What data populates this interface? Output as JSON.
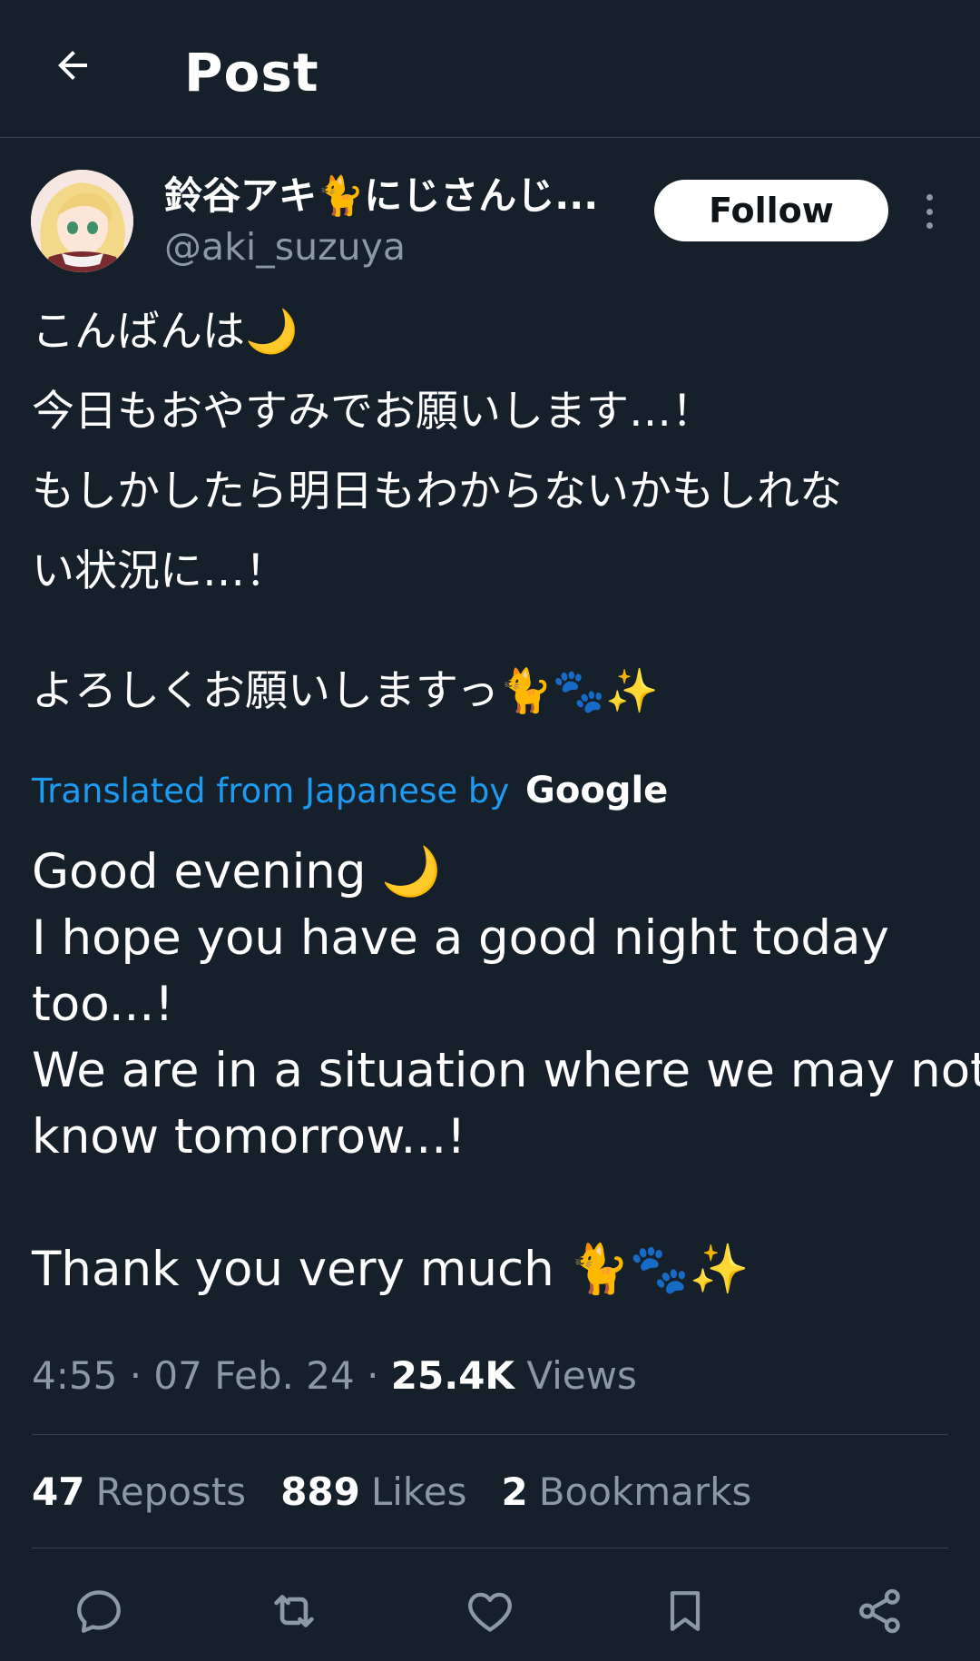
{
  "header": {
    "title": "Post",
    "back_icon": "arrow-left-icon"
  },
  "author": {
    "display_name": "鈴谷アキ🐈にじさんじ...",
    "handle": "@aki_suzuya",
    "follow_label": "Follow"
  },
  "post": {
    "original_lines": [
      "こんばんは🌙",
      "今日もおやすみでお願いします…！",
      "もしかしたら明日もわからないかもしれな",
      "い状況に…！",
      "",
      "よろしくお願いしますっ🐈🐾✨"
    ],
    "translated_label": "Translated from Japanese by",
    "translator": "Google",
    "translation_lines": [
      "Good evening 🌙",
      "I hope you have a good night today",
      "too...!",
      "We are in a situation where we may not",
      "know tomorrow...!",
      "",
      "Thank you very much 🐈🐾✨"
    ]
  },
  "meta": {
    "time": "4:55",
    "sep1": "·",
    "date": "07 Feb. 24",
    "sep2": "·",
    "views_count": "25.4K",
    "views_label": "Views"
  },
  "stats": {
    "reposts_count": "47",
    "reposts_label": "Reposts",
    "likes_count": "889",
    "likes_label": "Likes",
    "bookmarks_count": "2",
    "bookmarks_label": "Bookmarks"
  },
  "actions": [
    {
      "name": "reply",
      "icon": "reply-icon"
    },
    {
      "name": "repost",
      "icon": "repost-icon"
    },
    {
      "name": "like",
      "icon": "heart-icon"
    },
    {
      "name": "bookmark",
      "icon": "bookmark-icon"
    },
    {
      "name": "share",
      "icon": "share-icon"
    }
  ],
  "colors": {
    "background": "#15202b",
    "link": "#1d9bf0",
    "secondary_text": "#8b98a5",
    "divider": "#38444d"
  }
}
